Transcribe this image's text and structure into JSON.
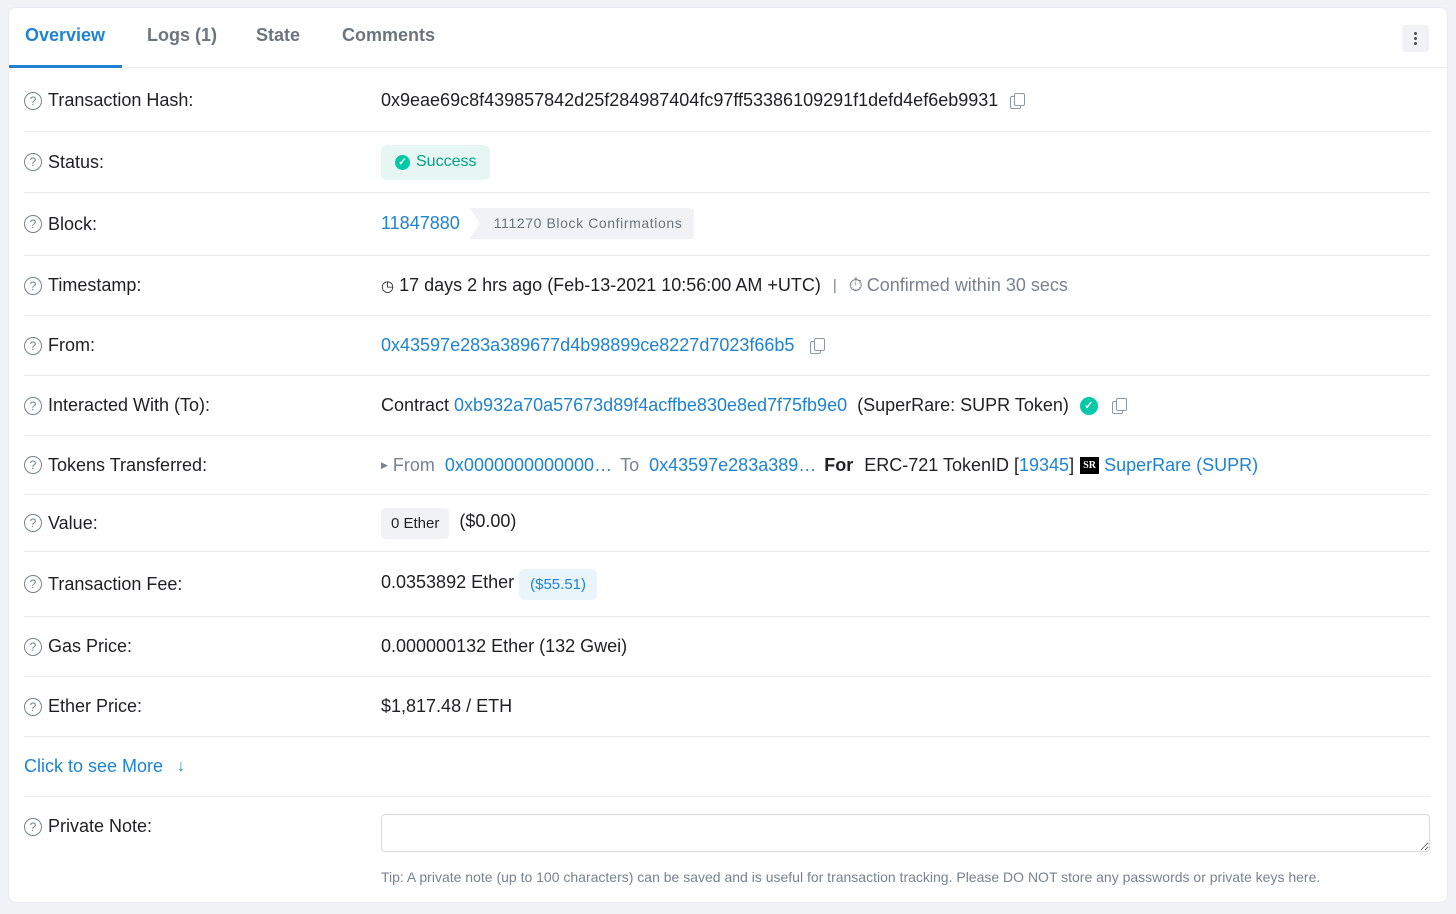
{
  "tabs": [
    {
      "label": "Overview",
      "active": true
    },
    {
      "label": "Logs (1)",
      "active": false
    },
    {
      "label": "State",
      "active": false
    },
    {
      "label": "Comments",
      "active": false
    }
  ],
  "more_icon": "kebab-menu-icon",
  "rows": {
    "tx_hash": {
      "label": "Transaction Hash:",
      "value": "0x9eae69c8f439857842d25f284987404fc97ff53386109291f1defd4ef6eb9931"
    },
    "status": {
      "label": "Status:",
      "value": "Success",
      "color": "#00c9a7"
    },
    "block": {
      "label": "Block:",
      "value": "11847880",
      "confirmations": "111270 Block Confirmations"
    },
    "timestamp": {
      "label": "Timestamp:",
      "value": "17 days 2 hrs ago (Feb-13-2021 10:56:00 AM +UTC)",
      "separator": "|",
      "confirmed": "Confirmed within 30 secs"
    },
    "from": {
      "label": "From:",
      "value": "0x43597e283a389677d4b98899ce8227d7023f66b5"
    },
    "to": {
      "label": "Interacted With (To):",
      "prefix": "Contract",
      "address": "0xb932a70a57673d89f4acffbe830e8ed7f75fb9e0",
      "name": "(SuperRare: SUPR Token)"
    },
    "tokens": {
      "label": "Tokens Transferred:",
      "from_label": "From",
      "from": "0x0000000000000…",
      "to_label": "To",
      "to": "0x43597e283a389…",
      "for_label": "For",
      "token_type": "ERC-721 TokenID [",
      "token_id": "19345",
      "token_close": "]",
      "logo_text": "SR",
      "token_name": "SuperRare (SUPR)"
    },
    "value": {
      "label": "Value:",
      "amount": "0 Ether",
      "usd": "($0.00)"
    },
    "fee": {
      "label": "Transaction Fee:",
      "amount": "0.0353892 Ether",
      "usd": "($55.51)"
    },
    "gas_price": {
      "label": "Gas Price:",
      "value": "0.000000132 Ether (132 Gwei)"
    },
    "ether_price": {
      "label": "Ether Price:",
      "value": "$1,817.48 / ETH"
    },
    "see_more": {
      "label": "Click to see More",
      "icon": "↓"
    },
    "private_note": {
      "label": "Private Note:",
      "input_value": "",
      "tip": "Tip: A private note (up to 100 characters) can be saved and is useful for transaction tracking. Please DO NOT store any passwords or private keys here."
    }
  },
  "colors": {
    "accent": "#1e83d0",
    "success": "#00c9a7",
    "muted": "#77838f"
  }
}
